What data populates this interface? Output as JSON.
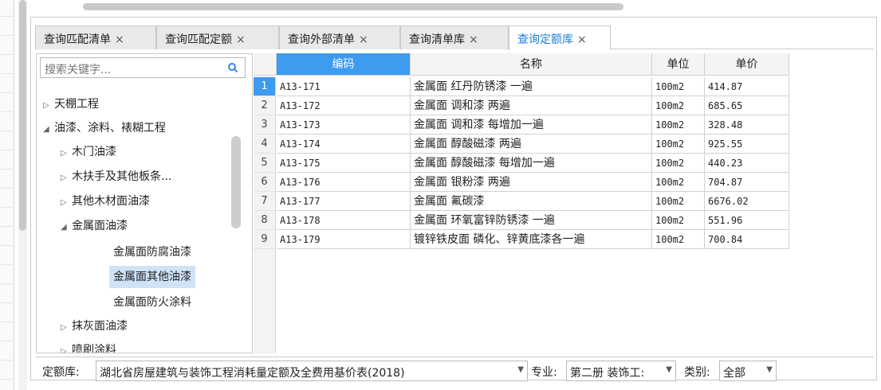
{
  "tabs": [
    {
      "label": "查询匹配清单",
      "close": "×"
    },
    {
      "label": "查询匹配定额",
      "close": "×"
    },
    {
      "label": "查询外部清单",
      "close": "×"
    },
    {
      "label": "查询清单库",
      "close": "×"
    },
    {
      "label": "查询定额库",
      "close": "×"
    }
  ],
  "search": {
    "placeholder": "搜索关键字..."
  },
  "tree": [
    {
      "label": "天棚工程",
      "toggle": "▷"
    },
    {
      "label": "油漆、涂料、裱糊工程",
      "toggle": "◢"
    },
    {
      "label": "木门油漆",
      "toggle": "▷"
    },
    {
      "label": "木扶手及其他板条...",
      "toggle": "▷"
    },
    {
      "label": "其他木材面油漆",
      "toggle": "▷"
    },
    {
      "label": "金属面油漆",
      "toggle": "◢"
    },
    {
      "label": "金属面防腐油漆",
      "toggle": ""
    },
    {
      "label": "金属面其他油漆",
      "toggle": ""
    },
    {
      "label": "金属面防火涂料",
      "toggle": ""
    },
    {
      "label": "抹灰面油漆",
      "toggle": "▷"
    },
    {
      "label": "喷刷涂料",
      "toggle": "▷"
    }
  ],
  "grid": {
    "columns": [
      "编码",
      "名称",
      "单位",
      "单价"
    ],
    "rows": [
      {
        "n": "1",
        "code": "A13-171",
        "name": "金属面 红丹防锈漆 一遍",
        "unit": "100m2",
        "price": "414.87"
      },
      {
        "n": "2",
        "code": "A13-172",
        "name": "金属面 调和漆 两遍",
        "unit": "100m2",
        "price": "685.65"
      },
      {
        "n": "3",
        "code": "A13-173",
        "name": "金属面 调和漆 每增加一遍",
        "unit": "100m2",
        "price": "328.48"
      },
      {
        "n": "4",
        "code": "A13-174",
        "name": "金属面 醇酸磁漆 两遍",
        "unit": "100m2",
        "price": "925.55"
      },
      {
        "n": "5",
        "code": "A13-175",
        "name": "金属面 醇酸磁漆 每增加一遍",
        "unit": "100m2",
        "price": "440.23"
      },
      {
        "n": "6",
        "code": "A13-176",
        "name": "金属面 银粉漆 两遍",
        "unit": "100m2",
        "price": "704.87"
      },
      {
        "n": "7",
        "code": "A13-177",
        "name": "金属面 氟碳漆",
        "unit": "100m2",
        "price": "6676.02"
      },
      {
        "n": "8",
        "code": "A13-178",
        "name": "金属面 环氧富锌防锈漆 一遍",
        "unit": "100m2",
        "price": "551.96"
      },
      {
        "n": "9",
        "code": "A13-179",
        "name": "镀锌铁皮面 磷化、锌黄底漆各一遍",
        "unit": "100m2",
        "price": "700.84"
      }
    ]
  },
  "bottom": {
    "quota_label": "定额库:",
    "quota_value": "湖北省房屋建筑与装饰工程消耗量定额及全费用基价表(2018)",
    "major_label": "专业:",
    "major_value": "第二册 装饰工:",
    "category_label": "类别:",
    "category_value": "全部",
    "arrow": "▼"
  },
  "colors": {
    "accent": "#3d9bf0",
    "active_tab_text": "#1e7fd8",
    "selected_node": "#cfe3f7"
  }
}
